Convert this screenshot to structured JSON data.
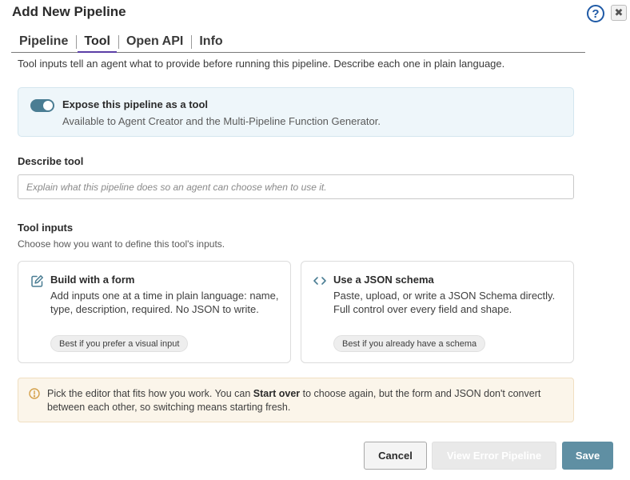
{
  "dialog": {
    "title": "Add New Pipeline",
    "help_icon": "question-circle-icon",
    "close_icon": "close-icon",
    "help_label": "?",
    "close_label": "✖"
  },
  "tabs": [
    {
      "label": "Pipeline",
      "active": false
    },
    {
      "label": "Tool",
      "active": true
    },
    {
      "label": "Open API",
      "active": false
    },
    {
      "label": "Info",
      "active": false
    }
  ],
  "intro": "Tool inputs tell an agent what to provide before running this pipeline. Describe each one in plain language.",
  "expose": {
    "enabled": true,
    "title": "Expose this pipeline as a tool",
    "subtitle": "Available to Agent Creator and the Multi-Pipeline Function Generator."
  },
  "describe": {
    "label": "Describe tool",
    "value": "",
    "placeholder": "Explain what this pipeline does so an agent can choose when to use it."
  },
  "tool_inputs": {
    "label": "Tool inputs",
    "subtitle": "Choose how you want to define this tool's inputs.",
    "options": [
      {
        "icon": "edit-icon",
        "title": "Build with a form",
        "description": "Add inputs one at a time in plain language: name, type, description, required. No JSON to write.",
        "badge": "Best if you prefer a visual input"
      },
      {
        "icon": "code-icon",
        "title": "Use a JSON schema",
        "description": "Paste, upload, or write a JSON Schema directly. Full control over every field and shape.",
        "badge": "Best if you already have a schema"
      }
    ]
  },
  "notice": {
    "icon": "info-circle-icon",
    "before": "Pick the editor that fits how you work. You can ",
    "emphasis": "Start over",
    "after": " to choose again, but the form and JSON don't convert between each other, so switching means starting fresh."
  },
  "footer": {
    "cancel_label": "Cancel",
    "error_pipeline_label": "View Error Pipeline",
    "save_label": "Save"
  },
  "colors": {
    "accent": "#5f8fa3",
    "toggle_on": "#4a7d93",
    "tab_underline": "#5b3fa6",
    "help_icon": "#1f5aa6",
    "notice_icon": "#d4a04a"
  }
}
